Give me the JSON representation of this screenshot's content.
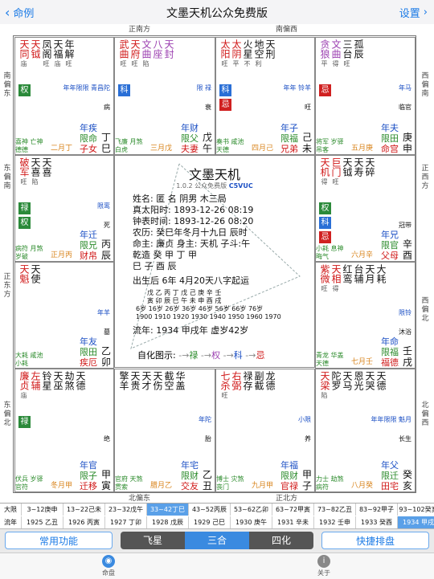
{
  "nav": {
    "back_label": "命例",
    "title": "文墨天机公众免费版",
    "settings_label": "设置"
  },
  "directions": {
    "top_left": "正南方",
    "top_right": "南偏西",
    "left_1": "南偏东",
    "left_2": "东偏南",
    "left_3": "正东方",
    "left_4": "东偏北",
    "right_1": "西偏南",
    "right_2": "正西方",
    "right_3": "西偏北",
    "right_4": "北偏西",
    "bottom_left": "北偏东",
    "bottom_right": "正北方"
  },
  "palaces": [
    {
      "id": "si",
      "stars": [
        {
          "n": "天同",
          "b": "庙",
          "c": "red"
        },
        {
          "n": "天钺",
          "b": "",
          "c": "red"
        },
        {
          "n": "凤阁",
          "b": "旺",
          "c": "black"
        },
        {
          "n": "天福",
          "b": "庙",
          "c": "black"
        },
        {
          "n": "年解",
          "b": "旺",
          "c": "black"
        }
      ],
      "hua": "权",
      "minor": "喜神 亡神 德德",
      "age": "二月丁",
      "life": "年疾 限命 子女",
      "gz": "丁巳",
      "extra": "年年限限 青昌陀",
      "huanote": "病"
    },
    {
      "id": "wu",
      "stars": [
        {
          "n": "武曲",
          "b": "旺",
          "c": "red"
        },
        {
          "n": "天府",
          "b": "旺",
          "c": "red"
        },
        {
          "n": "文曲",
          "b": "陷",
          "c": "purple"
        },
        {
          "n": "八座",
          "b": "",
          "c": "purple"
        },
        {
          "n": "天封",
          "b": "",
          "c": "purple"
        }
      ],
      "hua": "科",
      "minor": "飞廉 月煞 白虎",
      "age": "三月戊",
      "life": "年财 限父 夫妻",
      "gz": "戊午",
      "extra": "限 禄",
      "huanote": "衰"
    },
    {
      "id": "wei",
      "stars": [
        {
          "n": "太阳",
          "b": "旺",
          "c": "red"
        },
        {
          "n": "太阴",
          "b": "平",
          "c": "red"
        },
        {
          "n": "火星",
          "b": "不",
          "c": "black"
        },
        {
          "n": "地空",
          "b": "利",
          "c": "black"
        },
        {
          "n": "天刑",
          "b": "",
          "c": "black"
        }
      ],
      "hua": "科忌",
      "minor": "奏书 咸池 天德",
      "age": "四月己",
      "life": "年子 限福 兄弟",
      "gz": "己未",
      "extra": "年年 铃羊",
      "huanote": "旺"
    },
    {
      "id": "shen",
      "stars": [
        {
          "n": "贪狼",
          "b": "平",
          "c": "purple"
        },
        {
          "n": "文曲",
          "b": "得",
          "c": "purple"
        },
        {
          "n": "三台",
          "b": "旺",
          "c": "black"
        },
        {
          "n": "孤辰",
          "b": "",
          "c": "black"
        }
      ],
      "hua": "忌",
      "minor": "将军 岁驿 吊客",
      "age": "五月庚",
      "life": "年夫 限田 命宫",
      "gz": "庚申",
      "extra": "年马",
      "huanote": "临官"
    },
    {
      "id": "chen",
      "stars": [
        {
          "n": "破军",
          "b": "旺",
          "c": "red"
        },
        {
          "n": "天喜",
          "b": "陷",
          "c": "black"
        },
        {
          "n": "天喜",
          "b": "",
          "c": "black"
        }
      ],
      "hua": "禄权",
      "minor": "病符 月煞 岁破",
      "age": "正月丙",
      "life": "年迁 限兄 财帛",
      "gz": "丙辰",
      "extra": "限鸾",
      "huanote": "死"
    },
    {
      "id": "you",
      "stars": [
        {
          "n": "天机",
          "b": "得",
          "c": "red"
        },
        {
          "n": "巨门",
          "b": "旺",
          "c": "red"
        },
        {
          "n": "天钺",
          "b": "",
          "c": "black"
        },
        {
          "n": "天寿",
          "b": "",
          "c": "black"
        },
        {
          "n": "天碎",
          "b": "",
          "c": "black"
        }
      ],
      "hua": "权 科忌",
      "minor": "小耗 息神 晦气",
      "age": "六月辛",
      "life": "年兄 限官 父母",
      "gz": "辛酉",
      "extra": "",
      "huanote": "冠带"
    },
    {
      "id": "mao",
      "stars": [
        {
          "n": "天魁",
          "b": "",
          "c": "red"
        },
        {
          "n": "天使",
          "b": "",
          "c": "black"
        }
      ],
      "hua": "",
      "minor": "大耗 咸池 小耗",
      "age": "",
      "life": "年友 限田 疾厄",
      "gz": "乙卯",
      "extra": "年羊",
      "huanote": "墓"
    },
    {
      "id": "xu",
      "stars": [
        {
          "n": "紫微",
          "b": "旺",
          "c": "red"
        },
        {
          "n": "天相",
          "b": "得",
          "c": "red"
        },
        {
          "n": "红鸾",
          "b": "",
          "c": "black"
        },
        {
          "n": "台辅",
          "b": "",
          "c": "black"
        },
        {
          "n": "天月",
          "b": "",
          "c": "black"
        },
        {
          "n": "大耗",
          "b": "",
          "c": "black"
        }
      ],
      "hua": "",
      "minor": "青龙 华盖 天德",
      "age": "七月壬",
      "life": "年命 限福 福德",
      "gz": "壬戌",
      "extra": "限铃",
      "huanote": "沐浴"
    },
    {
      "id": "yin",
      "stars": [
        {
          "n": "廉贞",
          "b": "庙",
          "c": "red"
        },
        {
          "n": "左辅",
          "b": "",
          "c": "red"
        },
        {
          "n": "铃星",
          "b": "",
          "c": "black"
        },
        {
          "n": "天巫",
          "b": "",
          "c": "black"
        },
        {
          "n": "劫煞",
          "b": "",
          "c": "black"
        },
        {
          "n": "天德",
          "b": "",
          "c": "black"
        }
      ],
      "hua": "禄",
      "minor": "伏兵 岁驿 官符",
      "age": "冬月甲",
      "life": "年官 限子 迁移",
      "gz": "甲寅",
      "extra": "",
      "huanote": "绝"
    },
    {
      "id": "chou",
      "stars": [
        {
          "n": "擎羊",
          "b": "",
          "c": "black"
        },
        {
          "n": "天贵",
          "b": "",
          "c": "black"
        },
        {
          "n": "天才",
          "b": "",
          "c": "black"
        },
        {
          "n": "天伤",
          "b": "",
          "c": "black"
        },
        {
          "n": "截空",
          "b": "",
          "c": "black"
        },
        {
          "n": "华盖",
          "b": "",
          "c": "black"
        }
      ],
      "hua": "",
      "minor": "官府 天煞 贯索",
      "age": "腊月乙",
      "life": "年宅 限财 交友",
      "gz": "乙丑",
      "extra": "年陀",
      "huanote": "胎"
    },
    {
      "id": "zi",
      "stars": [
        {
          "n": "七杀",
          "b": "旺",
          "c": "red"
        },
        {
          "n": "右弼",
          "b": "",
          "c": "red"
        },
        {
          "n": "禄存",
          "b": "",
          "c": "black"
        },
        {
          "n": "副截",
          "b": "",
          "c": "black"
        },
        {
          "n": "龙德",
          "b": "",
          "c": "black"
        }
      ],
      "hua": "",
      "minor": "博士 灾煞 丧门",
      "age": "九月甲",
      "life": "年福 限财 官禄",
      "gz": "甲子",
      "extra": "小限",
      "huanote": "养"
    },
    {
      "id": "hai",
      "stars": [
        {
          "n": "天梁",
          "b": "陷",
          "c": "red"
        },
        {
          "n": "陀罗",
          "b": "",
          "c": "black"
        },
        {
          "n": "天马",
          "b": "",
          "c": "black"
        },
        {
          "n": "恩光",
          "b": "",
          "c": "black"
        },
        {
          "n": "天哭",
          "b": "",
          "c": "black"
        },
        {
          "n": "天德",
          "b": "",
          "c": "black"
        }
      ],
      "hua": "",
      "minor": "力士 劫煞 病符",
      "age": "八月癸",
      "life": "年父 限迁 田宅",
      "gz": "癸亥",
      "extra": "年年限限 魁月",
      "huanote": "长生"
    }
  ],
  "center": {
    "title": "文墨天机",
    "version": "1.0.2 公众免费版",
    "code": "C5VUC",
    "lines": [
      "姓名: 匿 名     阴男 木三局",
      "真太阳时: 1893-12-26  08:19",
      "钟表时间: 1893-12-26  08:20",
      "农历: 癸巳年冬月十九日 辰时",
      "命主: 廉贞 身主: 天机 子斗:午",
      "乾造  癸   甲   丁   甲",
      "      巳   子   酉   辰",
      "出生后 6年 4月20天八字起运"
    ],
    "bazi": [
      "戊 乙 丙 丁 戊 己 庚 辛 壬",
      "寅 卯 辰 巳 午 未 申 酉 戌",
      "6岁 16岁 26岁 36岁 46岁 56岁 66岁 76岁",
      "1900 1910 1920 1930 1940 1950 1960 1970"
    ],
    "liunian": "流年: 1934 甲戌年   虚岁42岁",
    "hua_title": "自化图示:",
    "hua_items": [
      "禄",
      "权",
      "科",
      "忌"
    ]
  },
  "years": {
    "row1_label": "大限",
    "row1": [
      "3~12庚申",
      "13~22己未",
      "23~32戊午",
      "33~42丁巳",
      "43~52丙辰",
      "53~62乙卯",
      "63~72甲寅",
      "73~82乙丑",
      "83~92甲子",
      "93~102癸亥"
    ],
    "row2_label": "流年",
    "row2": [
      "1925 乙丑",
      "1926 丙寅",
      "1927 丁卯",
      "1928 戊辰",
      "1929 己巳",
      "1930 庚午",
      "1931 辛未",
      "1932 壬申",
      "1933 癸酉",
      "1934 甲戌"
    ],
    "row1_selected": 3,
    "row2_selected": 9
  },
  "buttons": {
    "common": "常用功能",
    "feixing": "飞星",
    "sanhe": "三合",
    "sihua": "四化",
    "quick": "快捷排盘"
  },
  "tabs": {
    "chart": "命盘",
    "about": "关于"
  },
  "colors": {
    "accent": "#1a7ae6",
    "selected": "#3a8ae0",
    "red": "#d01818",
    "blue": "#1b4fc4",
    "green": "#2b8a3a"
  }
}
